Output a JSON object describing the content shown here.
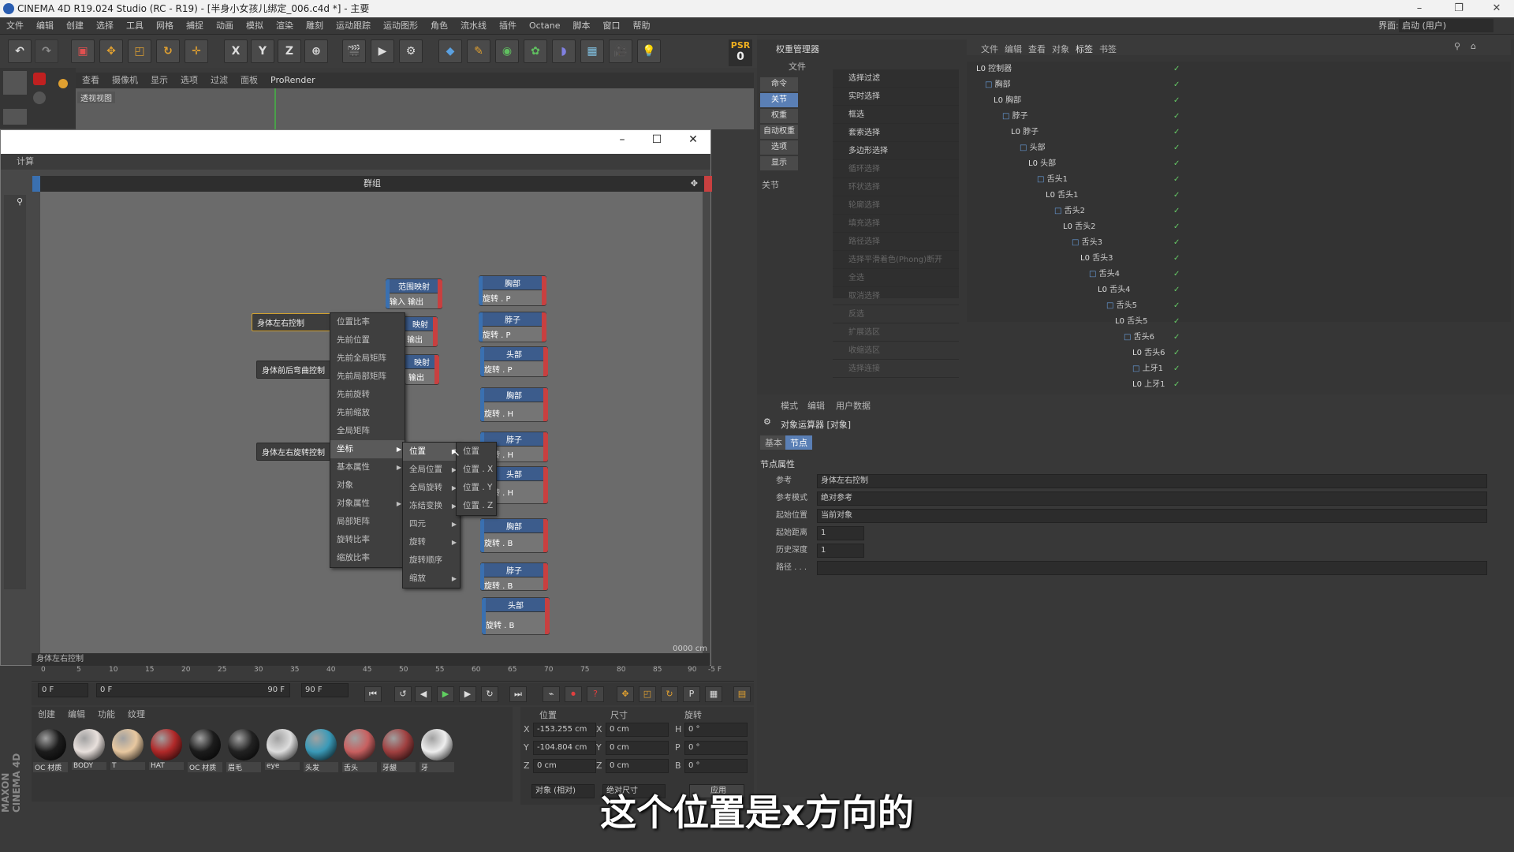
{
  "window": {
    "title": "CINEMA 4D R19.024 Studio (RC - R19) - [半身小女孩儿绑定_006.c4d *] - 主要"
  },
  "menu": [
    "文件",
    "编辑",
    "创建",
    "选择",
    "工具",
    "网格",
    "捕捉",
    "动画",
    "模拟",
    "渲染",
    "雕刻",
    "运动跟踪",
    "运动图形",
    "角色",
    "流水线",
    "插件",
    "Octane",
    "脚本",
    "窗口",
    "帮助"
  ],
  "interface": {
    "label": "界面:",
    "value": "启动 (用户)"
  },
  "psr": {
    "label": "PSR",
    "value": "0"
  },
  "toolbar": {
    "axes": [
      "X",
      "Y",
      "Z"
    ]
  },
  "viewport": {
    "menu": [
      "查看",
      "摄像机",
      "显示",
      "选项",
      "过滤",
      "面板",
      "ProRender"
    ],
    "label": "透视视图"
  },
  "xpresso": {
    "tab": "计算",
    "group_title": "群组",
    "status": "身体左右控制",
    "nodes_left": [
      "身体左右控制",
      "身体前后弯曲控制",
      "身体左右旋转控制"
    ],
    "range_nodes": [
      {
        "title": "范围映射",
        "body": "输入 输出"
      },
      {
        "title": "映射",
        "body": "输出"
      },
      {
        "title": "映射",
        "body": "输出"
      }
    ],
    "target_nodes": [
      {
        "title": "胸部",
        "body": "旋转 . P"
      },
      {
        "title": "脖子",
        "body": "旋转 . P"
      },
      {
        "title": "头部",
        "body": "旋转 . P"
      },
      {
        "title": "胸部",
        "body": "旋转 . H"
      },
      {
        "title": "脖子",
        "body": "旋转 . H"
      },
      {
        "title": "头部",
        "body": "旋转 . H"
      },
      {
        "title": "胸部",
        "body": "旋转 . B"
      },
      {
        "title": "脖子",
        "body": "旋转 . B"
      },
      {
        "title": "头部",
        "body": "旋转 . B"
      }
    ],
    "menu1": [
      "位置比率",
      "先前位置",
      "先前全局矩阵",
      "先前局部矩阵",
      "先前旋转",
      "先前缩放",
      "全局矩阵",
      "坐标",
      "基本属性",
      "对象",
      "对象属性",
      "局部矩阵",
      "旋转比率",
      "缩放比率"
    ],
    "menu2": [
      "位置",
      "全局位置",
      "全局旋转",
      "冻结变换",
      "四元",
      "旋转",
      "旋转顺序",
      "缩放"
    ],
    "menu3": [
      "位置",
      "位置 . X",
      "位置 . Y",
      "位置 . Z"
    ],
    "right_readout": "0000 cm"
  },
  "timeline": {
    "ticks": [
      "0",
      "5",
      "10",
      "15",
      "20",
      "25",
      "30",
      "35",
      "40",
      "45",
      "50",
      "55",
      "60",
      "65",
      "70",
      "75",
      "80",
      "85",
      "90"
    ],
    "end": "-5 F",
    "start_field": "0 F",
    "range_start": "0 F",
    "range_end": "90 F",
    "end_field": "90 F"
  },
  "materials": {
    "menu": [
      "创建",
      "编辑",
      "功能",
      "纹理"
    ],
    "items": [
      {
        "name": "OC 材质",
        "color": "#1c1c1c"
      },
      {
        "name": "BODY",
        "color": "#e8e0dc"
      },
      {
        "name": "T",
        "color": "#e8c8a0"
      },
      {
        "name": "HAT",
        "color": "#b02828"
      },
      {
        "name": "OC 材质",
        "color": "#1c1c1c"
      },
      {
        "name": "眉毛",
        "color": "#222222"
      },
      {
        "name": "eye",
        "color": "#dddddd"
      },
      {
        "name": "头发",
        "color": "#3a9ab8"
      },
      {
        "name": "舌头",
        "color": "#c86060"
      },
      {
        "name": "牙龈",
        "color": "#a04040"
      },
      {
        "name": "牙",
        "color": "#eeeeee"
      }
    ]
  },
  "coords": {
    "headers": [
      "位置",
      "尺寸",
      "旋转"
    ],
    "rows": [
      {
        "axis": "X",
        "pos": "-153.255 cm",
        "saxis": "X",
        "size": "0 cm",
        "raxis": "H",
        "rot": "0 °"
      },
      {
        "axis": "Y",
        "pos": "-104.804 cm",
        "saxis": "Y",
        "size": "0 cm",
        "raxis": "P",
        "rot": "0 °"
      },
      {
        "axis": "Z",
        "pos": "0 cm",
        "saxis": "Z",
        "size": "0 cm",
        "raxis": "B",
        "rot": "0 °"
      }
    ],
    "mode": "对象 (相对)",
    "size_mode": "绝对尺寸",
    "apply": "应用"
  },
  "maxon": "MAXON CINEMA 4D",
  "weights": {
    "title": "权重管理器",
    "file": "文件",
    "tabs": [
      "命令",
      "关节",
      "权重",
      "自动权重",
      "选项",
      "显示"
    ],
    "joints_label": "关节",
    "commands": [
      "选择过滤",
      "实时选择",
      "框选",
      "套索选择",
      "多边形选择"
    ],
    "commands_dim": [
      "循环选择",
      "环状选择",
      "轮廓选择",
      "填充选择",
      "路径选择",
      "选择平滑着色(Phong)断开",
      "全选",
      "取消选择",
      "反选",
      "扩展选区",
      "收缩选区",
      "选择连接"
    ]
  },
  "objects": {
    "menu": [
      "文件",
      "编辑",
      "查看",
      "对象",
      "标签",
      "书签"
    ],
    "tree": [
      "控制器",
      "胸部",
      "胸部",
      "脖子",
      "脖子",
      "头部",
      "头部",
      "舌头1",
      "舌头1",
      "舌头2",
      "舌头2",
      "舌头3",
      "舌头3",
      "舌头4",
      "舌头4",
      "舌头5",
      "舌头5",
      "舌头6",
      "舌头6",
      "上牙1",
      "上牙1"
    ]
  },
  "attributes": {
    "menu": [
      "模式",
      "编辑",
      "用户数据"
    ],
    "title": "对象运算器 [对象]",
    "tabs": [
      "基本",
      "节点"
    ],
    "section": "节点属性",
    "rows": [
      {
        "label": "参考",
        "value": "身体左右控制"
      },
      {
        "label": "参考模式",
        "value": "绝对参考"
      },
      {
        "label": "起始位置",
        "value": "当前对象"
      },
      {
        "label": "起始距离",
        "value": "1"
      },
      {
        "label": "历史深度",
        "value": "1"
      },
      {
        "label": "路径 . . .",
        "value": ""
      }
    ]
  },
  "subtitle": "这个位置是x方向的"
}
